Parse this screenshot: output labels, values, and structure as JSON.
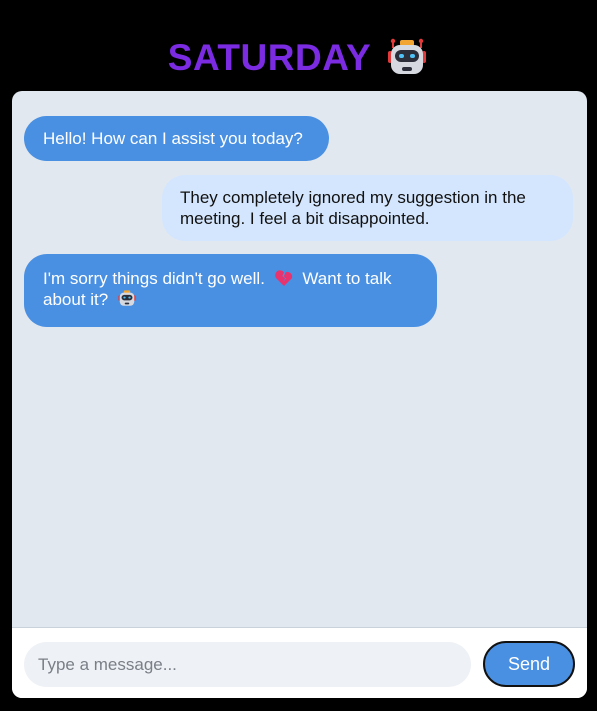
{
  "app": {
    "title": "SATURDAY",
    "title_icon": "robot-icon",
    "accent_color": "#7b2be2"
  },
  "messages": [
    {
      "sender": "bot",
      "text": "Hello! How can I assist you today?"
    },
    {
      "sender": "user",
      "text": "They completely ignored my suggestion in the meeting. I feel a bit disappointed."
    },
    {
      "sender": "bot",
      "text_part1": "I'm sorry things didn't go well.",
      "icon1": "broken-heart-icon",
      "text_part2": "Want to talk about it?",
      "icon2": "robot-icon"
    }
  ],
  "composer": {
    "placeholder": "Type a message...",
    "value": "",
    "send_label": "Send"
  },
  "colors": {
    "bot_bubble": "#4a90e2",
    "user_bubble": "#d4e6fd",
    "chat_background": "#e2e8f0"
  }
}
